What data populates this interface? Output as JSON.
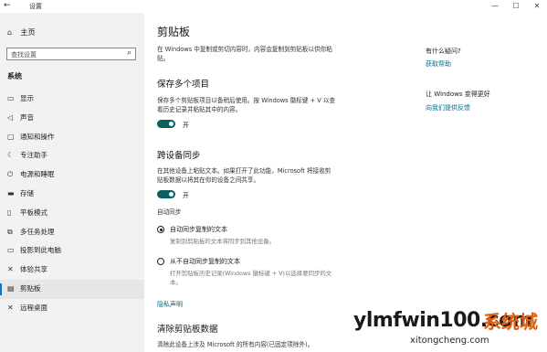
{
  "window": {
    "title": "设置",
    "back_icon": "back-arrow-icon",
    "controls": {
      "minimize": "—",
      "maximize": "☐",
      "close": "✕"
    }
  },
  "sidebar": {
    "home_label": "主页",
    "search_placeholder": "查找设置",
    "section_title": "系统",
    "items": [
      {
        "icon": "display-icon",
        "glyph": "▭",
        "label": "显示"
      },
      {
        "icon": "sound-icon",
        "glyph": "◁",
        "label": "声音"
      },
      {
        "icon": "notifications-icon",
        "glyph": "▢",
        "label": "通知和操作"
      },
      {
        "icon": "focus-assist-icon",
        "glyph": "☾",
        "label": "专注助手"
      },
      {
        "icon": "power-icon",
        "glyph": "⏻",
        "label": "电源和睡眠"
      },
      {
        "icon": "storage-icon",
        "glyph": "▬",
        "label": "存储"
      },
      {
        "icon": "tablet-icon",
        "glyph": "▯",
        "label": "平板模式"
      },
      {
        "icon": "multitasking-icon",
        "glyph": "⧉",
        "label": "多任务处理"
      },
      {
        "icon": "projecting-icon",
        "glyph": "▭",
        "label": "投影到此电脑"
      },
      {
        "icon": "shared-experiences-icon",
        "glyph": "✕",
        "label": "体验共享"
      },
      {
        "icon": "clipboard-icon",
        "glyph": "▤",
        "label": "剪贴板",
        "active": true
      },
      {
        "icon": "remote-desktop-icon",
        "glyph": "✕",
        "label": "远程桌面"
      }
    ]
  },
  "main": {
    "title": "剪贴板",
    "intro": [
      "在 Windows 中复制或剪切内容时，内容会复制到剪贴板以供你粘",
      "贴。"
    ],
    "history": {
      "heading": "保存多个项目",
      "desc": [
        "保存多个剪贴板项目以备稍后使用。按 Windows 徽标键 + V 以查",
        "看历史记录并粘贴其中的内容。"
      ],
      "toggle_label": "开"
    },
    "sync": {
      "heading": "跨设备同步",
      "desc": [
        "在其他设备上粘贴文本。如果打开了此功能，Microsoft 将接收剪",
        "贴板数据以将其在你的设备之间共享。"
      ],
      "toggle_label": "开",
      "auto_sync_label": "自动同步",
      "option1": {
        "label": "自动同步复制的文本",
        "desc": "复制到剪贴板的文本将同步到其他设备。"
      },
      "option2": {
        "label": "从不自动同步复制的文本",
        "desc": [
          "打开剪贴板历史记录(Windows 徽标键 + V)以选择要同步的文",
          "本。"
        ]
      }
    },
    "privacy_link": "隐私声明",
    "clear": {
      "heading": "清除剪贴板数据",
      "desc": "清除此设备上涉及 Microsoft 的所有内容(已固定项除外)。"
    }
  },
  "related": {
    "question": "有什么疑问?",
    "get_help": "获取帮助",
    "improve": "让 Windows 变得更好",
    "feedback": "向我们提供反馈"
  },
  "watermark": {
    "text": "ylmfwin100.com",
    "logo": "系统城",
    "url": "xitongcheng.com"
  }
}
